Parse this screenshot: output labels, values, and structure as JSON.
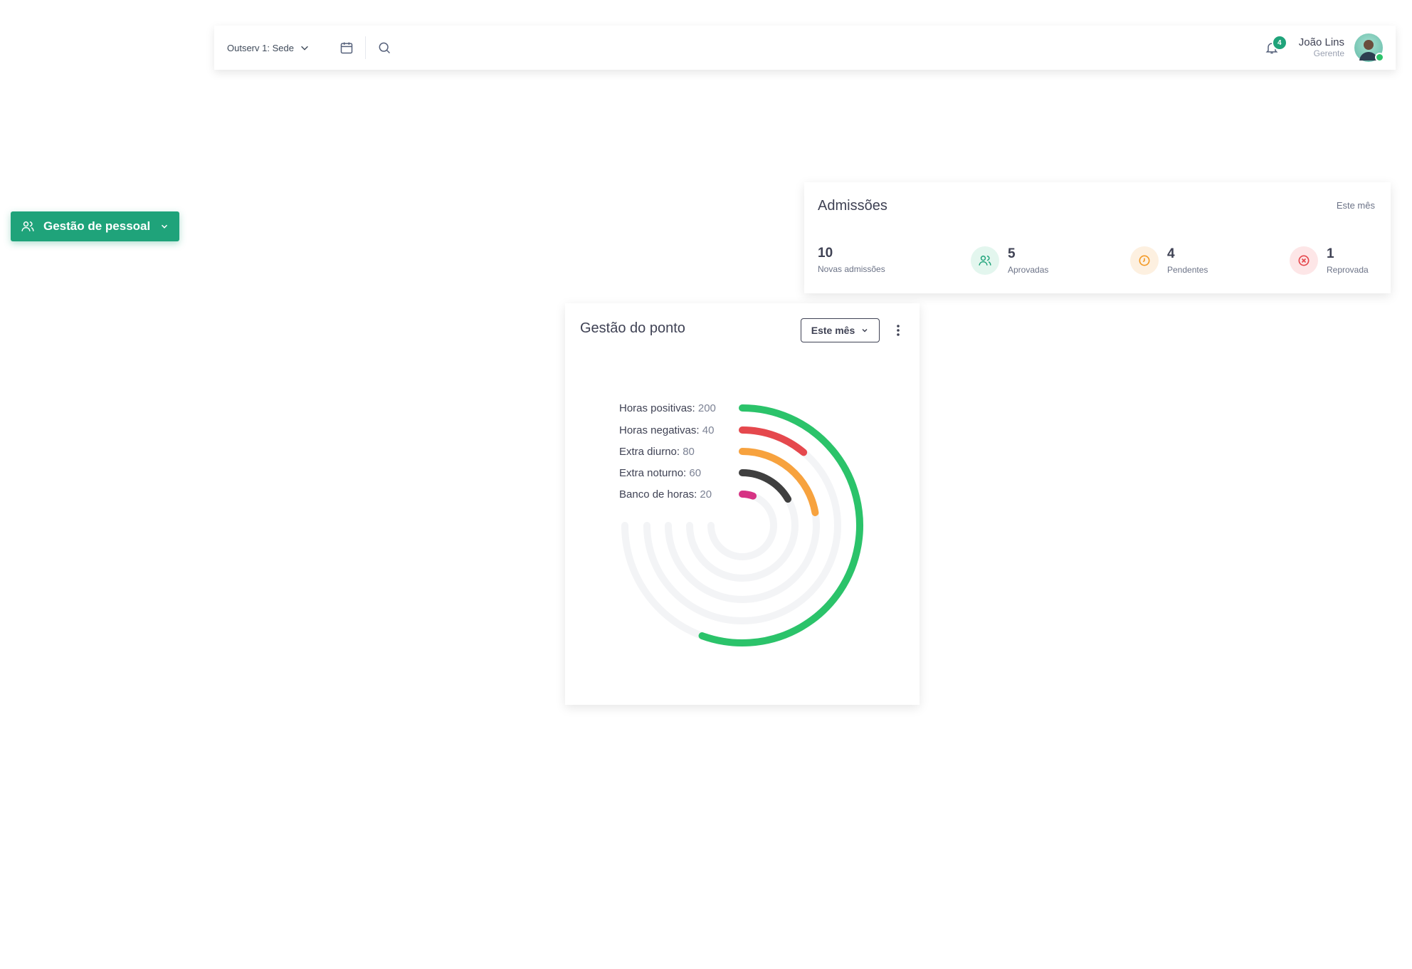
{
  "topbar": {
    "branch_label": "Outserv 1: Sede",
    "notifications_count": "4",
    "user_name": "João Lins",
    "user_role": "Gerente"
  },
  "nav": {
    "label": "Gestão de pessoal"
  },
  "admissions": {
    "title": "Admissões",
    "period": "Este mês",
    "stats": [
      {
        "value": "10",
        "label": "Novas admissões",
        "icon": "none"
      },
      {
        "value": "5",
        "label": "Aprovadas",
        "icon": "users-icon",
        "color": "#1fa37a",
        "bg": "#e3f6ee"
      },
      {
        "value": "4",
        "label": "Pendentes",
        "icon": "clock-icon",
        "color": "#f39a26",
        "bg": "#fdf0e0"
      },
      {
        "value": "1",
        "label": "Reprovada",
        "icon": "x-circle-icon",
        "color": "#e5484d",
        "bg": "#fde6e7"
      }
    ]
  },
  "ponto": {
    "title": "Gestão do ponto",
    "period": "Este mês"
  },
  "chart_data": {
    "type": "radial-bar",
    "series": [
      {
        "name": "Horas positivas",
        "value": 200,
        "color": "#2bc36a"
      },
      {
        "name": "Horas negativas",
        "value": 40,
        "color": "#e5484d"
      },
      {
        "name": "Extra diurno",
        "value": 80,
        "color": "#f7a23e"
      },
      {
        "name": "Extra noturno",
        "value": 60,
        "color": "#3f3f3f"
      },
      {
        "name": "Banco de horas",
        "value": 20,
        "color": "#d63384"
      }
    ],
    "max": 270,
    "track_color": "#f3f4f6"
  }
}
